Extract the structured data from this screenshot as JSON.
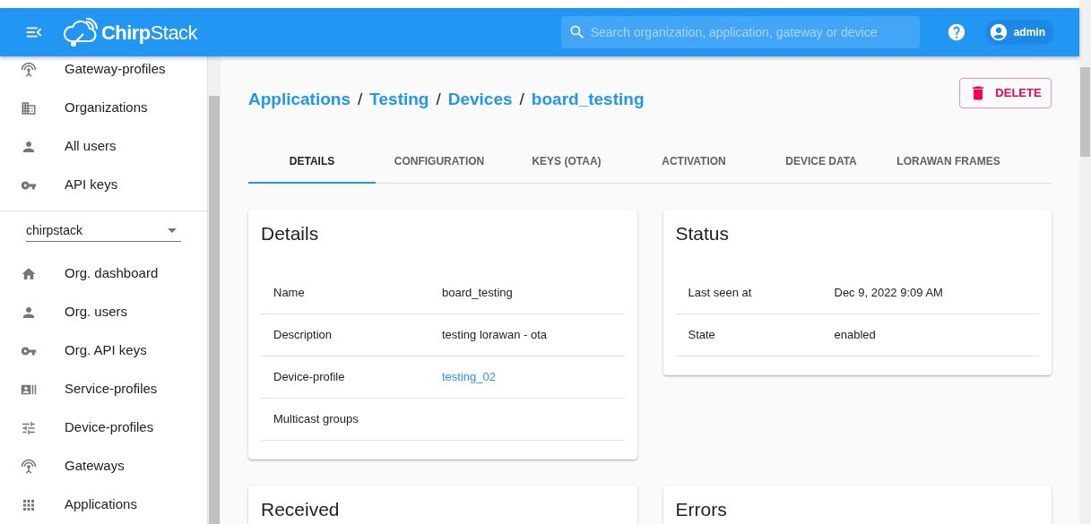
{
  "header": {
    "logo": "**Chirp**Stack",
    "search": {
      "placeholder": "Search organization, application, gateway or device"
    },
    "user": "admin"
  },
  "sidebar": {
    "items": [
      {
        "label": "Gateway-profiles",
        "kind": "antenna"
      },
      {
        "label": "Organizations",
        "kind": "building"
      },
      {
        "label": "All users",
        "kind": "person"
      },
      {
        "label": "API keys",
        "kind": "key"
      }
    ],
    "organization_select": {
      "value": "chirpstack"
    },
    "org_items": [
      {
        "label": "Org. dashboard",
        "kind": "home"
      },
      {
        "label": "Org. users",
        "kind": "person"
      },
      {
        "label": "Org. API keys",
        "kind": "key"
      },
      {
        "label": "Service-profiles",
        "kind": "profile"
      },
      {
        "label": "Device-profiles",
        "kind": "tune"
      },
      {
        "label": "Gateways",
        "kind": "antenna"
      },
      {
        "label": "Applications",
        "kind": "apps"
      }
    ]
  },
  "breadcrumb": [
    {
      "kind": "link",
      "text": "Applications"
    },
    {
      "kind": "separator",
      "text": "/"
    },
    {
      "kind": "link",
      "text": "Testing"
    },
    {
      "kind": "separator",
      "text": "/"
    },
    {
      "kind": "link",
      "text": "Devices"
    },
    {
      "kind": "separator",
      "text": "/"
    },
    {
      "kind": "link",
      "text": "board_testing"
    }
  ],
  "delete_button": "DELETE",
  "tabs": [
    {
      "label": "DETAILS",
      "selected": true
    },
    {
      "label": "CONFIGURATION",
      "selected": false
    },
    {
      "label": "KEYS (OTAA)",
      "selected": false
    },
    {
      "label": "ACTIVATION",
      "selected": false
    },
    {
      "label": "DEVICE DATA",
      "selected": false
    },
    {
      "label": "LORAWAN FRAMES",
      "selected": false
    }
  ],
  "details": {
    "title": "Details",
    "rows": [
      {
        "label": "Name",
        "value": "board_testing",
        "kind": "text"
      },
      {
        "label": "Description",
        "value": "testing lorawan - ota",
        "kind": "text"
      },
      {
        "label": "Device-profile",
        "value": "testing_02",
        "kind": "link"
      },
      {
        "label": "Multicast groups",
        "kind": "empty"
      }
    ]
  },
  "status": {
    "title": "Status",
    "rows": [
      {
        "label": "Last seen at",
        "value": "Dec 9, 2022 9:09 AM"
      },
      {
        "label": "State",
        "value": "enabled"
      }
    ]
  },
  "received": {
    "title": "Received"
  },
  "errors": {
    "title": "Errors"
  }
}
